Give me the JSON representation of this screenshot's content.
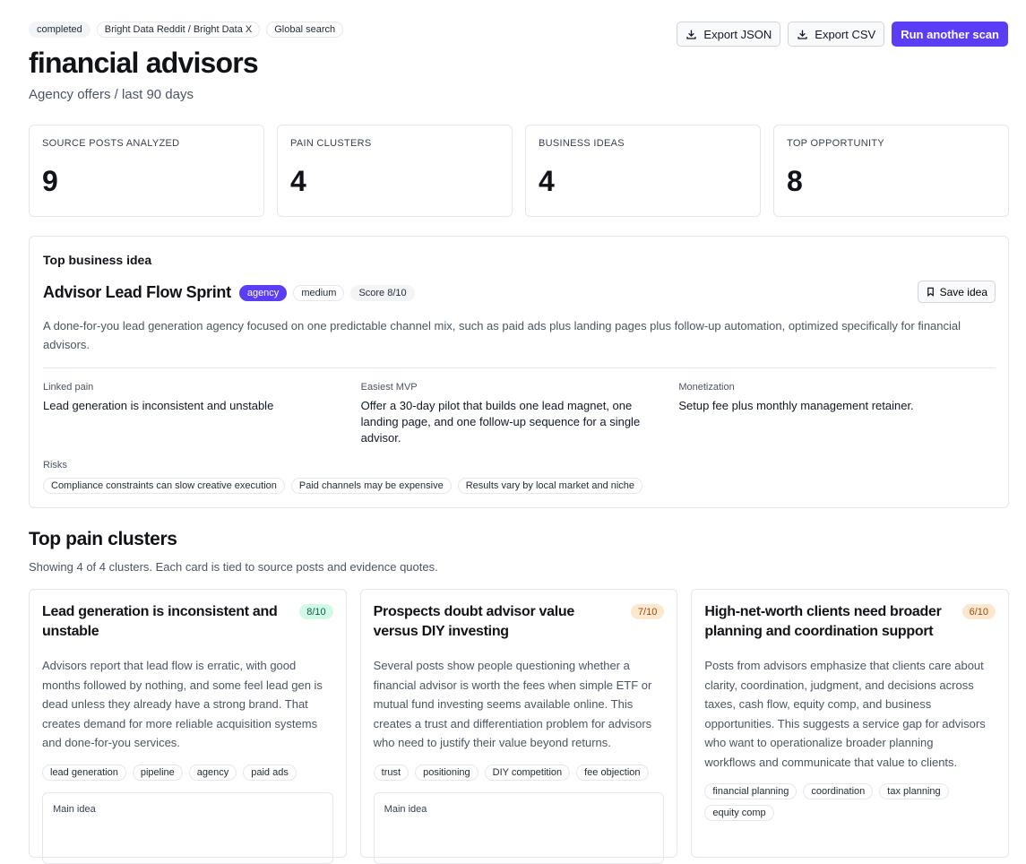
{
  "header": {
    "chips": [
      "completed",
      "Bright Data Reddit / Bright Data X",
      "Global search"
    ],
    "title": "financial advisors",
    "subtitle": "Agency offers / last 90 days",
    "buttons": {
      "export_json": "Export JSON",
      "export_csv": "Export CSV",
      "run_scan": "Run another scan"
    }
  },
  "stats": [
    {
      "label": "SOURCE POSTS ANALYZED",
      "value": "9"
    },
    {
      "label": "PAIN CLUSTERS",
      "value": "4"
    },
    {
      "label": "BUSINESS IDEAS",
      "value": "4"
    },
    {
      "label": "TOP OPPORTUNITY",
      "value": "8"
    }
  ],
  "top_idea": {
    "section_title": "Top business idea",
    "name": "Advisor Lead Flow Sprint",
    "badges": [
      "agency",
      "medium",
      "Score 8/10"
    ],
    "save_label": "Save idea",
    "description": "A done-for-you lead generation agency focused on one predictable channel mix, such as paid ads plus landing pages plus follow-up automation, optimized specifically for financial advisors.",
    "linked_pain_label": "Linked pain",
    "linked_pain": "Lead generation is inconsistent and unstable",
    "mvp_label": "Easiest MVP",
    "mvp": "Offer a 30-day pilot that builds one lead magnet, one landing page, and one follow-up sequence for a single advisor.",
    "monetization_label": "Monetization",
    "monetization": "Setup fee plus monthly management retainer.",
    "risks_label": "Risks",
    "risks": [
      "Compliance constraints can slow creative execution",
      "Paid channels may be expensive",
      "Results vary by local market and niche"
    ]
  },
  "pain_clusters": {
    "title": "Top pain clusters",
    "subtitle": "Showing 4 of 4 clusters. Each card is tied to source posts and evidence quotes.",
    "main_idea_label": "Main idea",
    "cards": [
      {
        "title": "Lead generation is inconsistent and unstable",
        "score": "8/10",
        "description": "Advisors report that lead flow is erratic, with good months followed by nothing, and some feel lead gen is dead unless they already have a strong brand. That creates demand for more reliable acquisition systems and done-for-you services.",
        "tags": [
          "lead generation",
          "pipeline",
          "agency",
          "paid ads"
        ]
      },
      {
        "title": "Prospects doubt advisor value versus DIY investing",
        "score": "7/10",
        "description": "Several posts show people questioning whether a financial advisor is worth the fees when simple ETF or mutual fund investing seems available online. This creates a trust and differentiation problem for advisors who need to justify their value beyond returns.",
        "tags": [
          "trust",
          "positioning",
          "DIY competition",
          "fee objection"
        ]
      },
      {
        "title": "High-net-worth clients need broader planning and coordination support",
        "score": "6/10",
        "description": "Posts from advisors emphasize that clients care about clarity, coordination, judgment, and decisions across taxes, cash flow, equity comp, and business opportunities. This suggests a service gap for advisors who want to operationalize broader planning workflows and communicate that value to clients.",
        "tags": [
          "financial planning",
          "coordination",
          "tax planning",
          "equity comp"
        ]
      }
    ]
  }
}
